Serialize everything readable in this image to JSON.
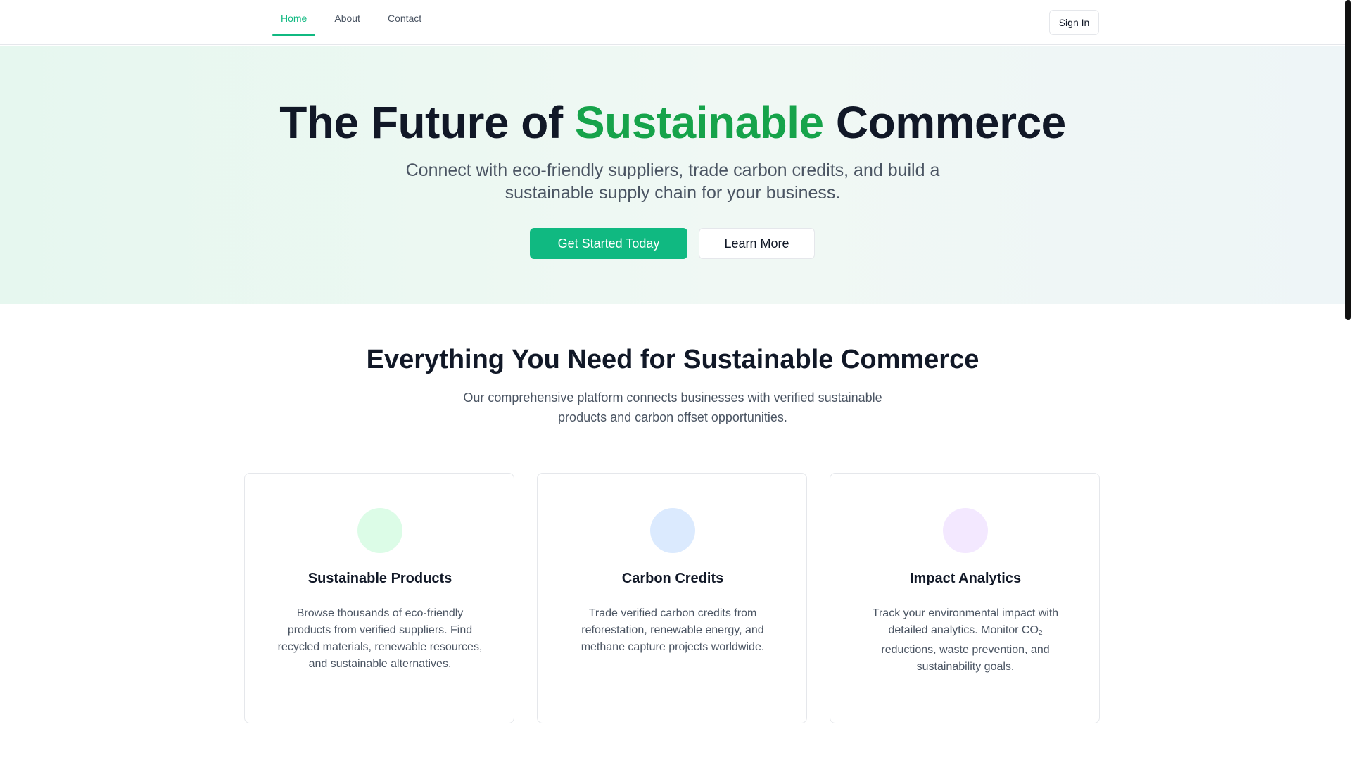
{
  "nav": {
    "items": [
      {
        "label": "Home",
        "active": true
      },
      {
        "label": "About",
        "active": false
      },
      {
        "label": "Contact",
        "active": false
      }
    ],
    "sign_in": "Sign In"
  },
  "hero": {
    "title_part1": "The Future of ",
    "title_accent": "Sustainable",
    "title_part2": " Commerce",
    "subtitle": "Connect with eco-friendly suppliers, trade carbon credits, and build a sustainable supply chain for your business.",
    "primary_button": "Get Started Today",
    "secondary_button": "Learn More"
  },
  "features": {
    "title": "Everything You Need for Sustainable Commerce",
    "subtitle": "Our comprehensive platform connects businesses with verified sustainable products and carbon offset opportunities.",
    "cards": [
      {
        "title": "Sustainable Products",
        "description": "Browse thousands of eco-friendly products from verified suppliers. Find recycled materials, renewable resources, and sustainable alternatives.",
        "icon_color": "#dcfce7"
      },
      {
        "title": "Carbon Credits",
        "description": "Trade verified carbon credits from reforestation, renewable energy, and methane capture projects worldwide.",
        "icon_color": "#dbeafe"
      },
      {
        "title": "Impact Analytics",
        "description_before": "Track your environmental impact with detailed analytics. Monitor CO",
        "description_sub": "2",
        "description_after": " reductions, waste prevention, and sustainability goals.",
        "icon_color": "#f3e8ff"
      }
    ]
  },
  "colors": {
    "accent": "#10b981",
    "title_accent": "#16a34a"
  }
}
